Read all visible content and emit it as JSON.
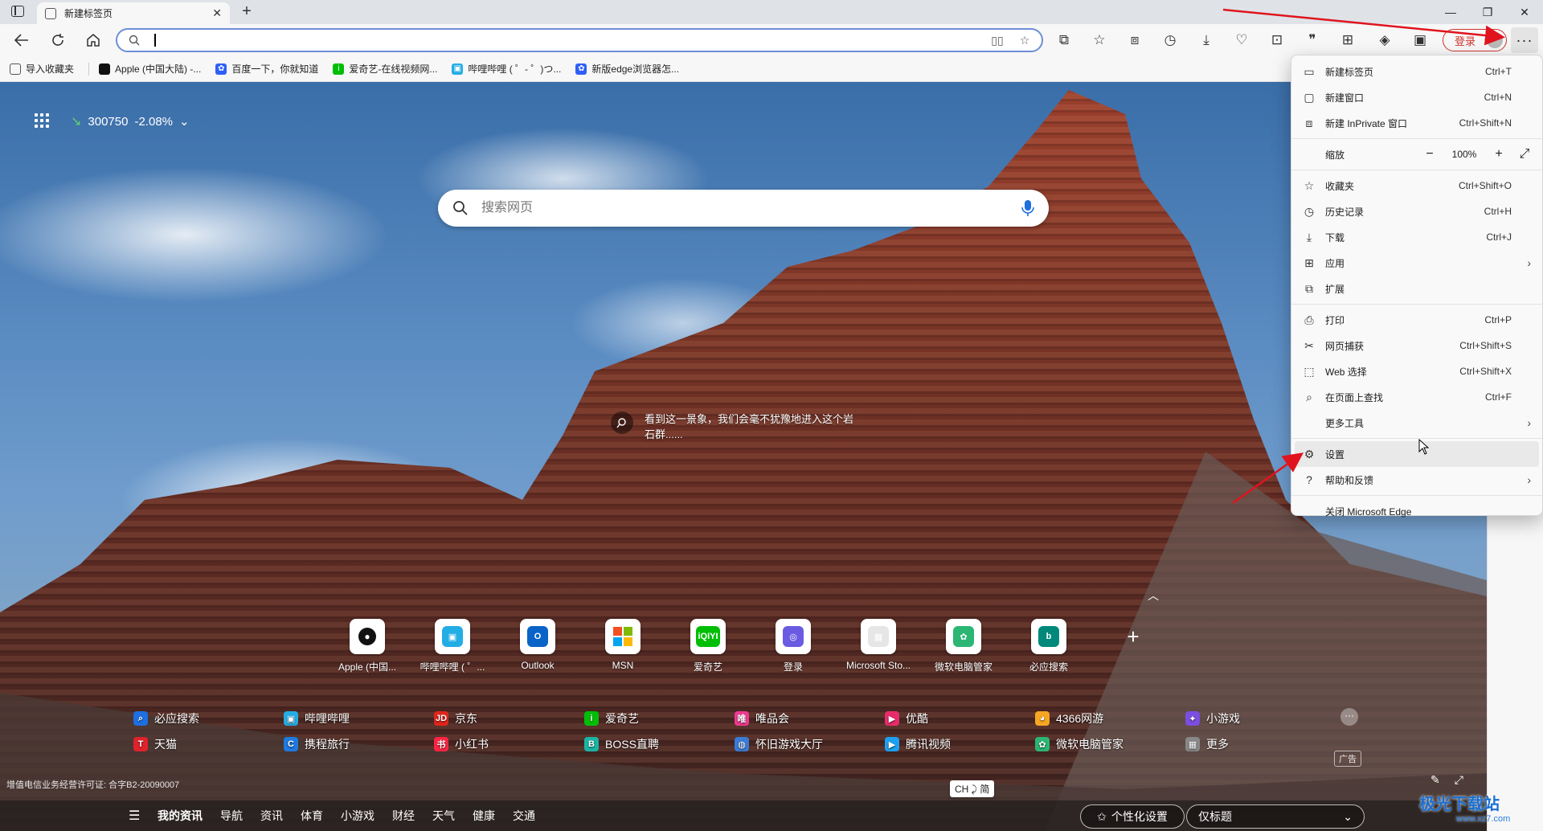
{
  "tab": {
    "title": "新建标签页"
  },
  "address": {
    "value": ""
  },
  "login": {
    "label": "登录"
  },
  "favorites": [
    {
      "label": "导入收藏夹",
      "color": "#555"
    },
    {
      "label": "Apple (中国大陆) -...",
      "color": "#111"
    },
    {
      "label": "百度一下，你就知道",
      "color": "#2f5ff5"
    },
    {
      "label": "爱奇艺-在线视频网...",
      "color": "#00be06"
    },
    {
      "label": "哔哩哔哩 ( ゜- ゜)つ...",
      "color": "#23ade5"
    },
    {
      "label": "新版edge浏览器怎...",
      "color": "#2f5ff5"
    }
  ],
  "stock": {
    "code": "300750",
    "change": "-2.08%"
  },
  "search": {
    "placeholder": "搜索网页"
  },
  "caption": {
    "text": "看到这一景象，我们会毫不犹豫地进入这个岩石群......"
  },
  "quicklinks": [
    {
      "label": "Apple (中国...",
      "icon": "apple-icon",
      "color": "#111",
      "glyph": ""
    },
    {
      "label": "哔哩哔哩 ( ゜...",
      "icon": "bilibili-icon",
      "color": "#23ade5",
      "glyph": "▣"
    },
    {
      "label": "Outlook",
      "icon": "outlook-icon",
      "color": "#0a64c8",
      "glyph": "O"
    },
    {
      "label": "MSN",
      "icon": "msn-icon",
      "color": "#f25022",
      "glyph": ""
    },
    {
      "label": "爱奇艺",
      "icon": "iqiyi-icon",
      "color": "#00be06",
      "glyph": "iQIYI"
    },
    {
      "label": "登录",
      "icon": "copilot-icon",
      "color": "#6a5be2",
      "glyph": "◎"
    },
    {
      "label": "Microsoft Sto...",
      "icon": "store-icon",
      "color": "#e6e6e6",
      "glyph": "▦"
    },
    {
      "label": "微软电脑管家",
      "icon": "pc-manager-icon",
      "color": "#2bb673",
      "glyph": "✿"
    },
    {
      "label": "必应搜索",
      "icon": "bing-icon",
      "color": "#00897b",
      "glyph": "b"
    }
  ],
  "sites": [
    {
      "label": "必应搜索",
      "icon": "bing-search-icon",
      "color": "#1e6fe0",
      "glyph": "⌕"
    },
    {
      "label": "哔哩哔哩",
      "icon": "bilibili-site-icon",
      "color": "#23ade5",
      "glyph": "▣"
    },
    {
      "label": "京东",
      "icon": "jd-icon",
      "color": "#e1251b",
      "glyph": "JD"
    },
    {
      "label": "爱奇艺",
      "icon": "iqiyi-site-icon",
      "color": "#00be06",
      "glyph": "i"
    },
    {
      "label": "唯品会",
      "icon": "vip-icon",
      "color": "#f03a8f",
      "glyph": "唯"
    },
    {
      "label": "优酷",
      "icon": "youku-icon",
      "color": "#e82c6b",
      "glyph": "▶"
    },
    {
      "label": "4366网游",
      "icon": "game4366-icon",
      "color": "#f5a623",
      "glyph": "◕"
    },
    {
      "label": "小游戏",
      "icon": "minigame-icon",
      "color": "#7b4ee0",
      "glyph": "✦"
    },
    {
      "label": "天猫",
      "icon": "tmall-icon",
      "color": "#e0222b",
      "glyph": "T"
    },
    {
      "label": "携程旅行",
      "icon": "ctrip-icon",
      "color": "#1f7ae0",
      "glyph": "C"
    },
    {
      "label": "小红书",
      "icon": "xiaohongshu-icon",
      "color": "#ff2442",
      "glyph": "书"
    },
    {
      "label": "BOSS直聘",
      "icon": "boss-icon",
      "color": "#19b5a4",
      "glyph": "B"
    },
    {
      "label": "怀旧游戏大厅",
      "icon": "retro-game-icon",
      "color": "#3a7bd5",
      "glyph": "◍"
    },
    {
      "label": "腾讯视频",
      "icon": "tencent-video-icon",
      "color": "#1ea0f0",
      "glyph": "▶"
    },
    {
      "label": "微软电脑管家",
      "icon": "pc-manager-site-icon",
      "color": "#2bb673",
      "glyph": "✿"
    },
    {
      "label": "更多",
      "icon": "more-sites-icon",
      "color": "#888",
      "glyph": "▦"
    }
  ],
  "ad_label": "广告",
  "license": "增值电信业务经营许可证: 合字B2-20090007",
  "ime": "CH ⤸ 简",
  "feed_tabs": [
    "我的资讯",
    "导航",
    "资讯",
    "体育",
    "小游戏",
    "财经",
    "天气",
    "健康",
    "交通"
  ],
  "personalize_label": "个性化设置",
  "layout_select": "仅标题",
  "watermark": {
    "title": "极光下载站",
    "url": "www.xz7.com"
  },
  "menu": {
    "new_tab": {
      "label": "新建标签页",
      "shortcut": "Ctrl+T"
    },
    "new_window": {
      "label": "新建窗口",
      "shortcut": "Ctrl+N"
    },
    "new_inprivate": {
      "label": "新建 InPrivate 窗口",
      "shortcut": "Ctrl+Shift+N"
    },
    "zoom": {
      "label": "缩放",
      "value": "100%"
    },
    "favorites": {
      "label": "收藏夹",
      "shortcut": "Ctrl+Shift+O"
    },
    "history": {
      "label": "历史记录",
      "shortcut": "Ctrl+H"
    },
    "downloads": {
      "label": "下载",
      "shortcut": "Ctrl+J"
    },
    "apps": {
      "label": "应用"
    },
    "extensions": {
      "label": "扩展"
    },
    "print": {
      "label": "打印",
      "shortcut": "Ctrl+P"
    },
    "screenshot": {
      "label": "网页捕获",
      "shortcut": "Ctrl+Shift+S"
    },
    "web_select": {
      "label": "Web 选择",
      "shortcut": "Ctrl+Shift+X"
    },
    "find": {
      "label": "在页面上查找",
      "shortcut": "Ctrl+F"
    },
    "more_tools": {
      "label": "更多工具"
    },
    "settings": {
      "label": "设置"
    },
    "help": {
      "label": "帮助和反馈"
    },
    "close_edge": {
      "label": "关闭 Microsoft Edge"
    }
  }
}
